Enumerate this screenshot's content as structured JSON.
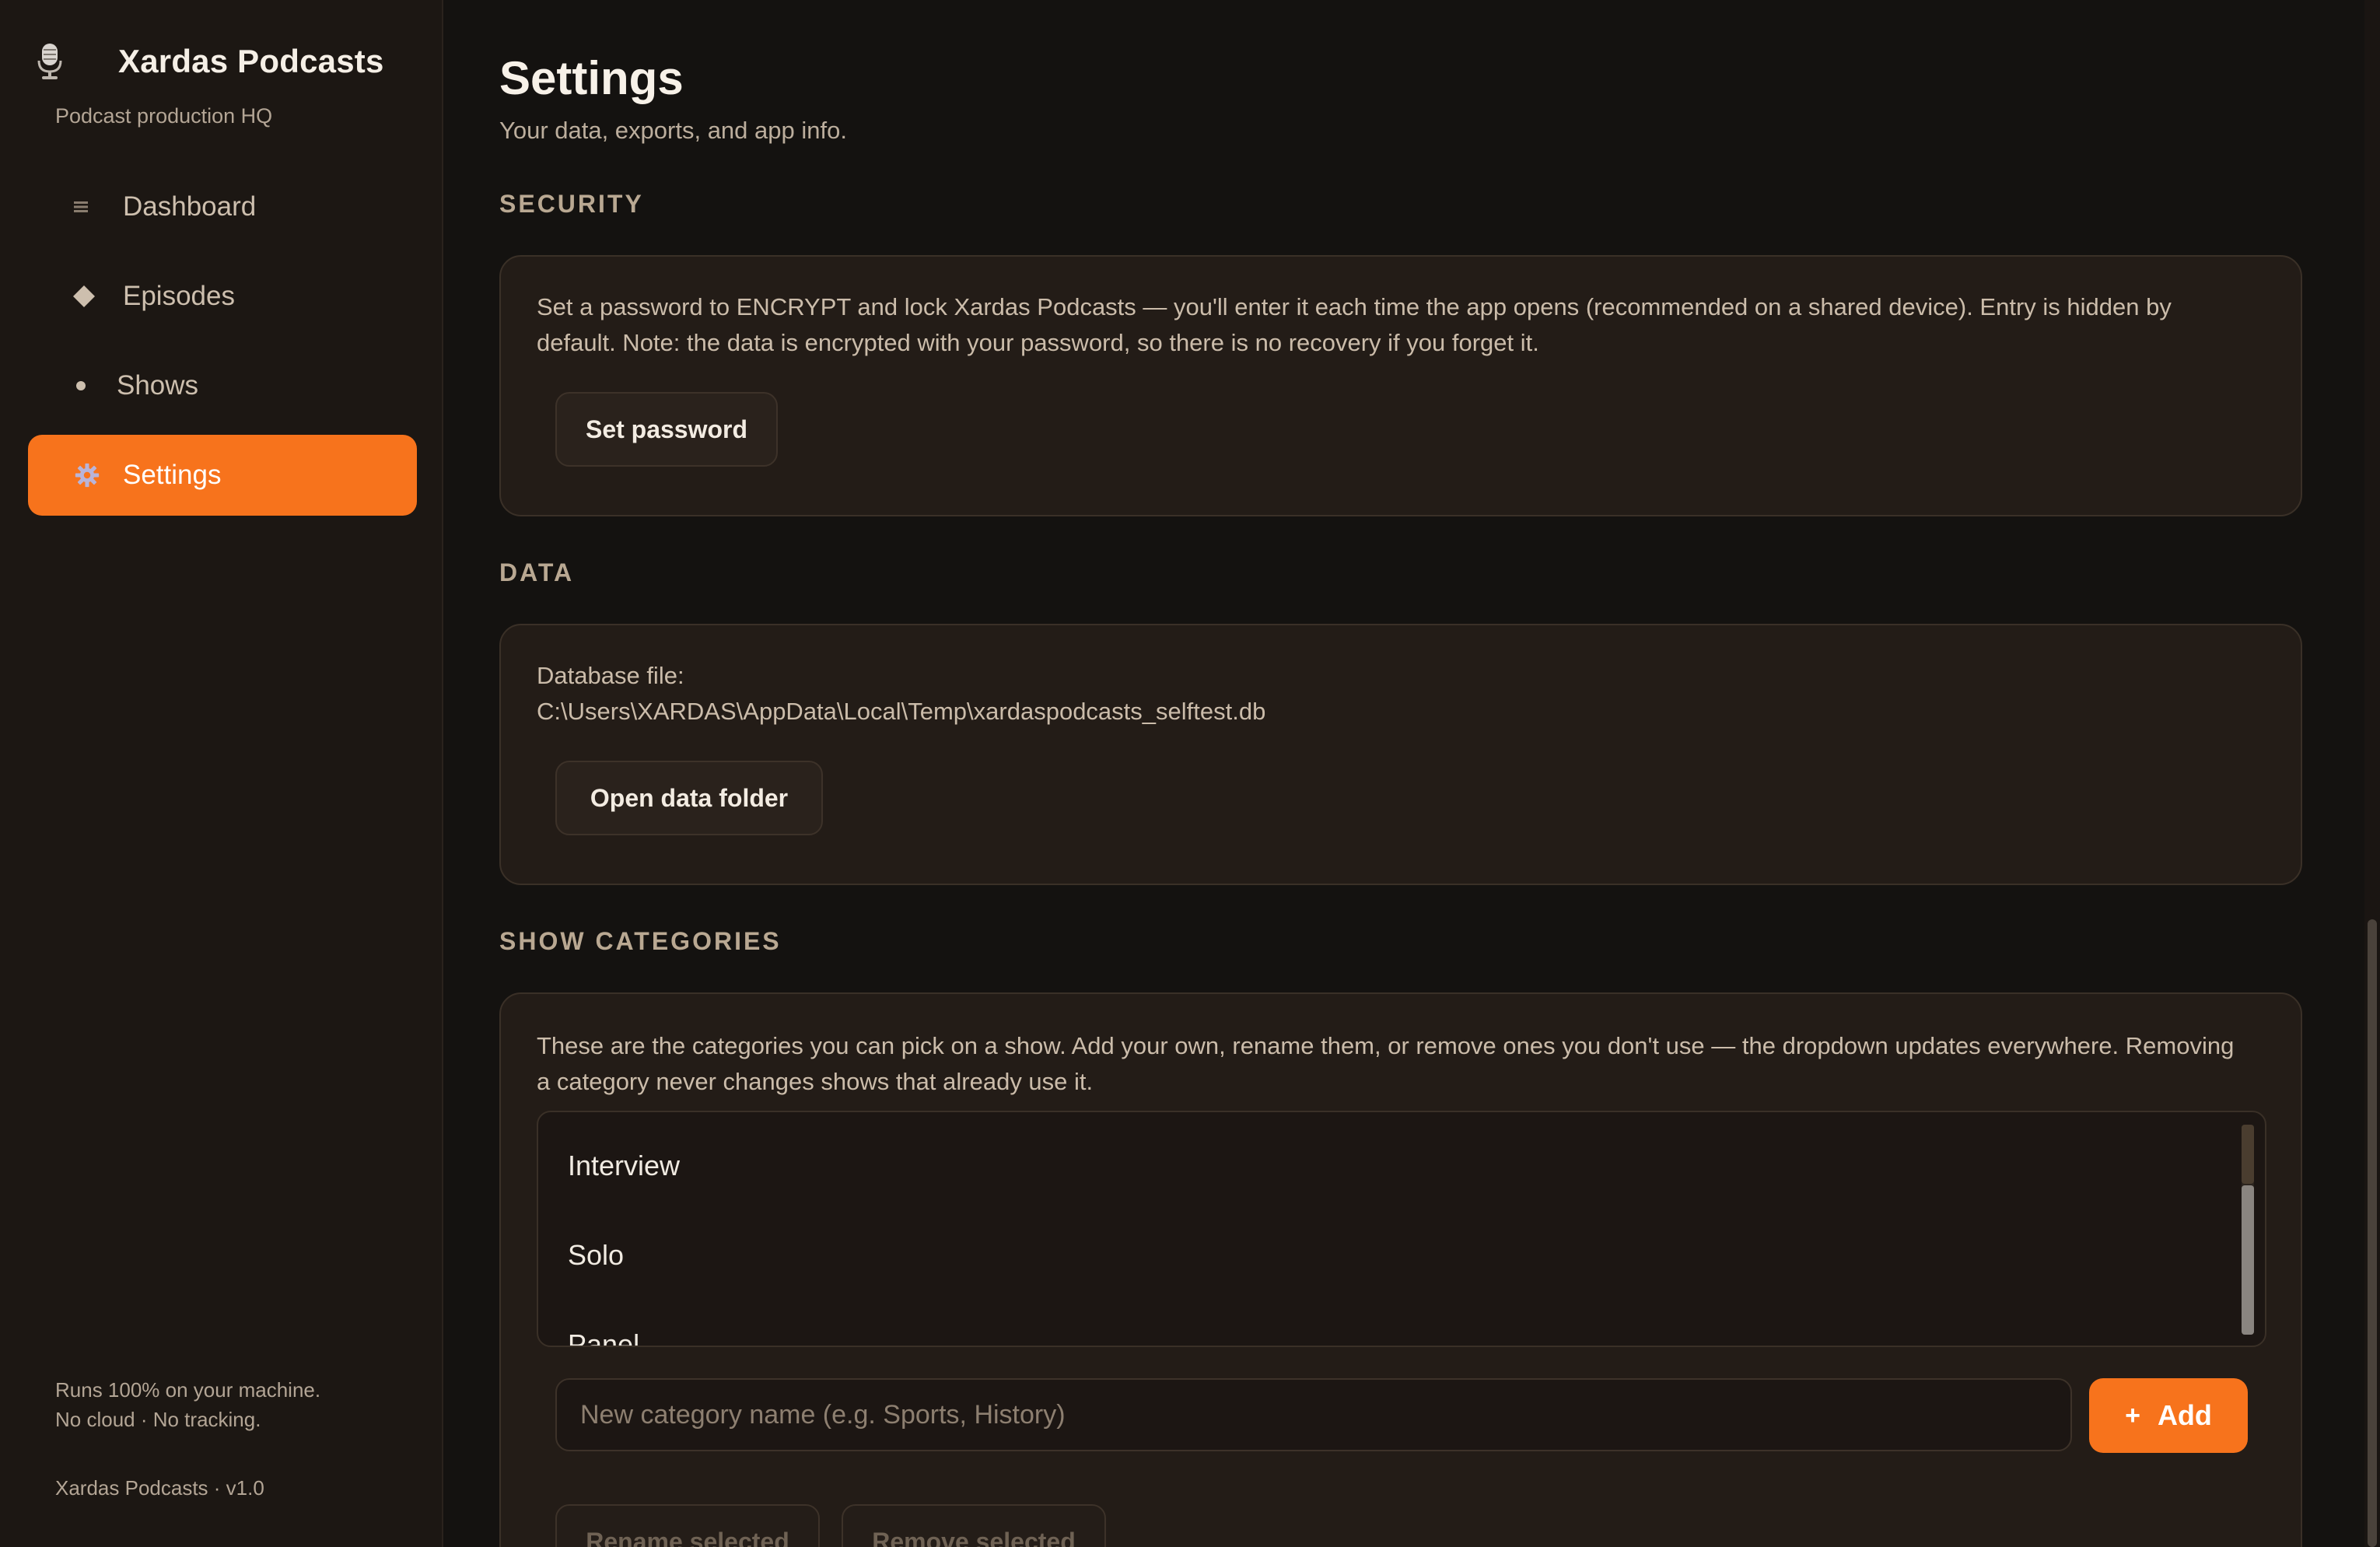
{
  "sidebar": {
    "brand_title": "Xardas Podcasts",
    "brand_subtitle": "Podcast production HQ",
    "brand_icon": "microphone-icon",
    "items": [
      {
        "label": "Dashboard",
        "icon": "grid-icon",
        "active": false
      },
      {
        "label": "Episodes",
        "icon": "diamond-icon",
        "active": false
      },
      {
        "label": "Shows",
        "icon": "dot-icon",
        "active": false
      },
      {
        "label": "Settings",
        "icon": "gear-icon",
        "active": true
      }
    ],
    "footer_line1": "Runs 100% on your machine.",
    "footer_line2": "No cloud · No tracking.",
    "version": "Xardas Podcasts · v1.0"
  },
  "page": {
    "title": "Settings",
    "subtitle": "Your data, exports, and app info."
  },
  "security": {
    "label": "SECURITY",
    "description": "Set a password to ENCRYPT and lock Xardas Podcasts — you'll enter it each time the app opens (recommended on a shared device). Entry is hidden by default. Note: the data is encrypted with your password, so there is no recovery if you forget it.",
    "button": "Set password"
  },
  "data": {
    "label": "DATA",
    "file_label": "Database file:",
    "file_path": "C:\\Users\\XARDAS\\AppData\\Local\\Temp\\xardaspodcasts_selftest.db",
    "button": "Open data folder"
  },
  "categories": {
    "label": "SHOW CATEGORIES",
    "description": "These are the categories you can pick on a show. Add your own, rename them, or remove ones you don't use — the dropdown updates everywhere. Removing a category never changes shows that already use it.",
    "items": [
      "Interview",
      "Solo",
      "Panel"
    ],
    "input_placeholder": "New category name (e.g. Sports, History)",
    "add_button": "Add",
    "rename_button": "Rename selected",
    "remove_button": "Remove selected"
  },
  "colors": {
    "accent": "#f7731c",
    "background": "#141210",
    "sidebar": "#1c1713",
    "card": "#231c17"
  }
}
